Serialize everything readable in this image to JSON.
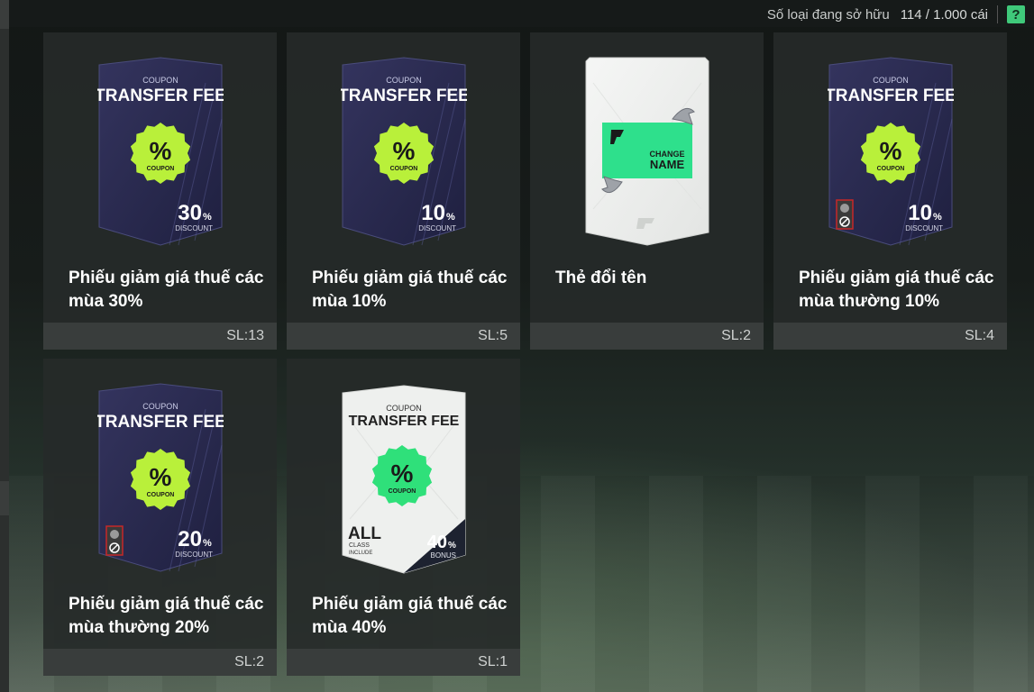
{
  "header": {
    "owned_label": "Số loại đang sở hữu",
    "owned_count": "114 / 1.000 cái",
    "help_label": "?"
  },
  "items": [
    {
      "name": "Phiếu giảm giá thuế các mùa 30%",
      "qty": "SL:13",
      "card": {
        "style": "dark",
        "coupon_label": "COUPON",
        "title": "TRANSFER FEE",
        "badge_symbol": "%",
        "badge_label": "COUPON",
        "value": "30",
        "value_unit": "%",
        "value_label": "DISCOUNT",
        "restricted": false
      }
    },
    {
      "name": "Phiếu giảm giá thuế các mùa 10%",
      "qty": "SL:5",
      "card": {
        "style": "dark",
        "coupon_label": "COUPON",
        "title": "TRANSFER FEE",
        "badge_symbol": "%",
        "badge_label": "COUPON",
        "value": "10",
        "value_unit": "%",
        "value_label": "DISCOUNT",
        "restricted": false
      }
    },
    {
      "name": "Thẻ đổi tên",
      "qty": "SL:2",
      "card": {
        "style": "rename",
        "line1": "CHANGE",
        "line2": "NAME"
      }
    },
    {
      "name": "Phiếu giảm giá thuế các mùa thường 10%",
      "qty": "SL:4",
      "card": {
        "style": "dark",
        "coupon_label": "COUPON",
        "title": "TRANSFER FEE",
        "badge_symbol": "%",
        "badge_label": "COUPON",
        "value": "10",
        "value_unit": "%",
        "value_label": "DISCOUNT",
        "restricted": true
      }
    },
    {
      "name": "Phiếu giảm giá thuế các mùa thường 20%",
      "qty": "SL:2",
      "card": {
        "style": "dark",
        "coupon_label": "COUPON",
        "title": "TRANSFER FEE",
        "badge_symbol": "%",
        "badge_label": "COUPON",
        "value": "20",
        "value_unit": "%",
        "value_label": "DISCOUNT",
        "restricted": true
      }
    },
    {
      "name": "Phiếu giảm giá thuế các mùa 40%",
      "qty": "SL:1",
      "card": {
        "style": "white",
        "coupon_label": "COUPON",
        "title": "TRANSFER FEE",
        "badge_symbol": "%",
        "badge_label": "COUPON",
        "value": "40",
        "value_unit": "%",
        "value_label": "BONUS",
        "class_main": "ALL",
        "class_sub1": "CLASS",
        "class_sub2": "INCLUDE",
        "restricted": false
      }
    }
  ],
  "colors": {
    "badge_lime": "#b9f03a",
    "badge_green": "#2fe07a",
    "card_dark": "#2b2c50",
    "help_green": "#3fc97a"
  }
}
